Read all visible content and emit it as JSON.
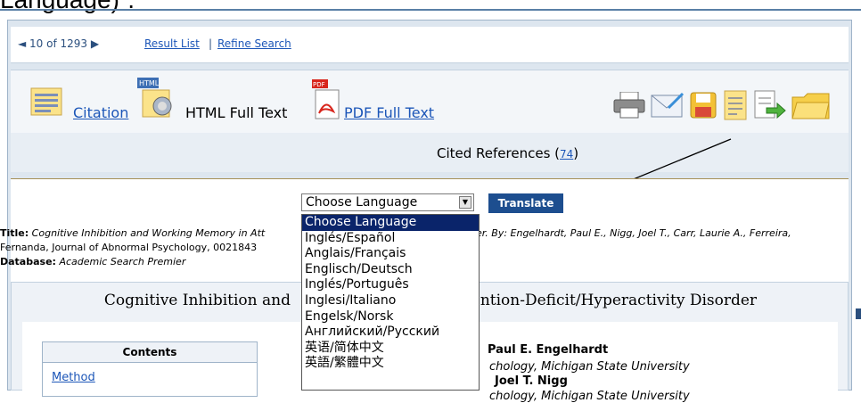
{
  "caption": {
    "text": "Language)˙."
  },
  "nav": {
    "count": "◄ 10 of 1293 ▶",
    "result_list": "Result List",
    "separator": "|",
    "refine_search": "Refine Search"
  },
  "formats": {
    "citation": "Citation",
    "html_full_text": "HTML Full Text",
    "pdf_full_text": "PDF Full Text",
    "cited_references_label": "Cited References (",
    "cited_references_count": "74",
    "cited_references_close": ")"
  },
  "toolbar_icons": [
    "print-icon",
    "email-icon",
    "save-icon",
    "cite-icon",
    "export-icon",
    "folder-icon"
  ],
  "translate": {
    "selected": "Choose Language",
    "button": "Translate",
    "options": [
      "Choose Language",
      "Inglés/Español",
      "Anglais/Français",
      "Englisch/Deutsch",
      "Inglés/Português",
      "Inglesi/Italiano",
      "Engelsk/Norsk",
      "Английский/Русский",
      "英语/简体中文",
      "英語/繁體中文"
    ]
  },
  "meta": {
    "title_label": "Title:",
    "title_value": "Cognitive Inhibition and Working Memory in Att",
    "title_tail": "er. By: Engelhardt, Paul E., Nigg, Joel T., Carr, Laurie A., Ferreira,",
    "line2": "Fernanda, Journal of Abnormal Psychology, 0021843",
    "database_label": "Database:",
    "database_value": "Academic Search Premier"
  },
  "article": {
    "title_left": "Cognitive Inhibition and",
    "title_right": "ention-Deficit/Hyperactivity Disorder",
    "contents_heading": "Contents",
    "contents_link": "Method",
    "author1": "Paul E. Engelhardt",
    "affil1": "chology, Michigan State University",
    "author2": "Joel T. Nigg",
    "affil2": "chology, Michigan State University"
  },
  "colors": {
    "accent_blue": "#1d4e8f",
    "link_blue": "#1c56b8",
    "panel_bg": "#dde6ef",
    "selected_bg": "#0a246a"
  }
}
